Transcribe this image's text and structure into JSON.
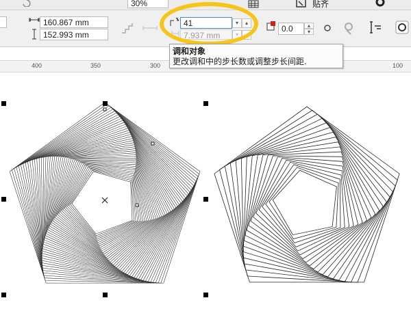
{
  "toolbar": {
    "zoom_partial": "30%",
    "width_value": "160.867 mm",
    "height_value": "152.993 mm",
    "blend_steps": "41",
    "step_spacing": "7.937 mm",
    "accel_value": "0.0",
    "right_label_partial": "贴齐"
  },
  "tooltip": {
    "title": "调和对象",
    "description": "更改调和中的步长数或调整步长间距."
  },
  "ruler": {
    "labels": [
      "400",
      "350",
      "300",
      "100"
    ]
  },
  "colors": {
    "highlight": "#f7c41a",
    "toolbar_bg": "#f0f0f0"
  }
}
